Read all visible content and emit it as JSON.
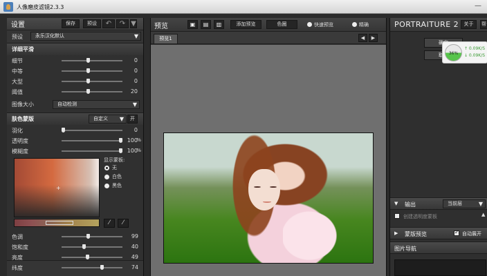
{
  "window": {
    "title": "人像磨皮滤镜2.3.3",
    "minimize": "—"
  },
  "left": {
    "title": "设置",
    "save": "保存",
    "preset": "预设",
    "undo": "↶",
    "redo": "↷",
    "menu": "▼",
    "preset_label": "预设",
    "preset_value": "永乐汉化默认",
    "detail_title": "详细平滑",
    "detail_sliders": [
      {
        "label": "细节",
        "value": "0",
        "fraction": 0.43
      },
      {
        "label": "中等",
        "value": "0",
        "fraction": 0.43
      },
      {
        "label": "大型",
        "value": "0",
        "fraction": 0.43
      },
      {
        "label": "阈值",
        "value": "20",
        "fraction": 0.43
      }
    ],
    "image_size_label": "图像大小",
    "image_size_value": "自动检测",
    "skin_title": "肤色蒙版",
    "skin_mode": "自定义",
    "skin_toggle": "开",
    "skin_sliders": [
      {
        "label": "羽化",
        "value": "0",
        "unit": "",
        "fraction": 0.0
      },
      {
        "label": "透明度",
        "value": "100",
        "unit": "%",
        "fraction": 1.0
      },
      {
        "label": "模糊度",
        "value": "100",
        "unit": "%",
        "fraction": 1.0
      }
    ],
    "show_mask_label": "显示蒙板:",
    "mask_options": [
      "无",
      "白色",
      "黑色"
    ],
    "tool1": "⁄",
    "tool2": "⁄",
    "color_sliders": [
      {
        "label": "色调",
        "value": "99",
        "fraction": 0.43
      },
      {
        "label": "饱和度",
        "value": "40",
        "fraction": 0.36
      },
      {
        "label": "亮度",
        "value": "49",
        "fraction": 0.42
      },
      {
        "label": "纬度",
        "value": "74",
        "fraction": 0.68
      }
    ]
  },
  "center": {
    "title": "预览",
    "add_preview": "添加预览",
    "color": "色圈",
    "fast_preview": "快速预览",
    "accurate": "精确",
    "tab": "预览1",
    "nav_left": "◀",
    "nav_right": "▶"
  },
  "right": {
    "brand": "PORTRAITURE 2",
    "about": "关于",
    "help": "帮",
    "ok": "确定",
    "cancel": "取消",
    "speed_percent": "36%",
    "upload": "↑ 0.09K/S",
    "download": "↓ 0.09K/S",
    "output_title": "输出",
    "output_value": "当前层",
    "transparent_mask": "创建透明度蒙板",
    "mask_preview": "蒙版预览",
    "auto_expand": "自动展开",
    "image_nav": "图片导航"
  },
  "colors": {
    "panel": "#353535",
    "canvas": "#6f6f6f",
    "accent": "#57c44b"
  }
}
